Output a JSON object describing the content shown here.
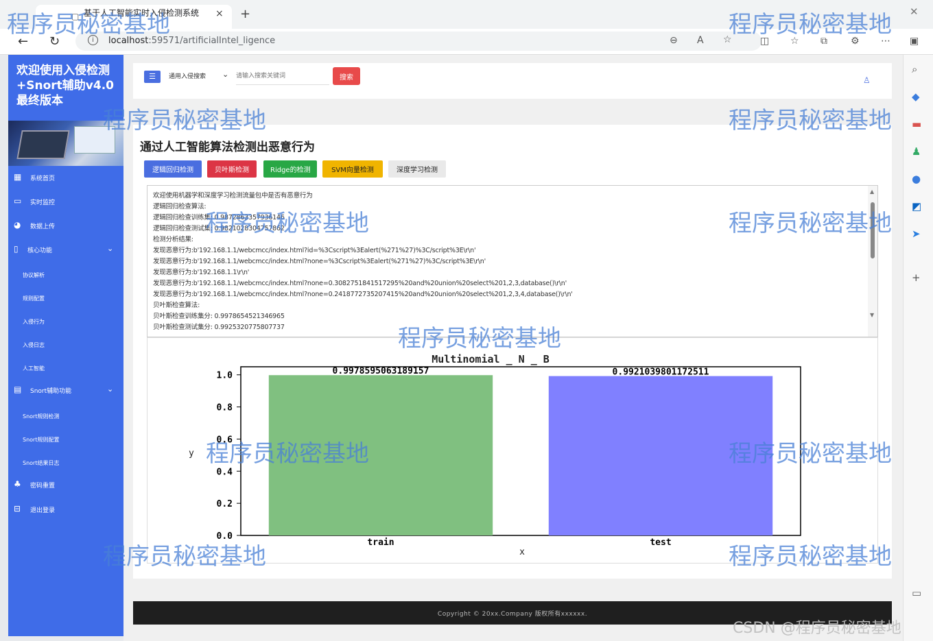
{
  "browser": {
    "tab_title": "基于人工智能实时入侵检测系统",
    "tab_close": "×",
    "new_tab": "+",
    "window_close": "✕",
    "url_host": "localhost",
    "url_rest": ":59571/artificialIntel_ligence"
  },
  "sidebar": {
    "brand": "欢迎使用入侵检测+Snort辅助v4.0最终版本",
    "items": [
      {
        "label": "系统首页",
        "icon": "grid-icon"
      },
      {
        "label": "实时监控",
        "icon": "monitor-icon"
      },
      {
        "label": "数据上传",
        "icon": "pie-icon"
      },
      {
        "label": "核心功能",
        "icon": "doc-icon"
      }
    ],
    "core_sub": [
      "协议解析",
      "规则配置",
      "入侵行为",
      "入侵日志",
      "人工智能"
    ],
    "snort_group": "Snort辅助功能",
    "snort_sub": [
      "Snort规则检测",
      "Snort规则配置",
      "Snort结果日志"
    ],
    "extra_items": [
      {
        "label": "密码重置",
        "icon": "users-icon"
      },
      {
        "label": "退出登录",
        "icon": "exit-icon"
      }
    ]
  },
  "topbar": {
    "select_value": "通用入侵搜索",
    "search_placeholder": "请输入搜索关键词",
    "search_button": "搜索"
  },
  "main": {
    "title": "通过人工智能算法检测出恶意行为",
    "buttons": [
      {
        "label": "逻辑回归检测",
        "color": "#4a6ee0"
      },
      {
        "label": "贝叶斯检测",
        "color": "#dc3545"
      },
      {
        "label": "Ridge的检测",
        "color": "#28a745"
      },
      {
        "label": "SVM向量检测",
        "color": "#f0b400"
      },
      {
        "label": "深度学习检测",
        "color": "#e9e9e9"
      }
    ],
    "log_lines": [
      "欢迎使用机器学和深度学习检测流量包中是否有恶意行为",
      "逻辑回归检查算法:",
      "逻辑回归检查训练集: 0.9872863357936146",
      "逻辑回归检查测试集: 0.9821028304757862",
      "检测分析结果:",
      "发现恶意行为:b'192.168.1.1/webcmcc/index.html?id=%3Cscript%3Ealert(%271%27)%3C/script%3E\\r\\n'",
      "发现恶意行为:b'192.168.1.1/webcmcc/index.html?none=%3Cscript%3Ealert(%271%27)%3C/script%3E\\r\\n'",
      "发现恶意行为:b'192.168.1.1\\r\\n'",
      "发现恶意行为:b'192.168.1.1/webcmcc/index.html?none=0.3082751841517295%20and%20union%20select%201,2,3,database()\\r\\n'",
      "发现恶意行为:b'192.168.1.1/webcmcc/index.html?none=0.2418772735207415%20and%20union%20select%201,2,3,4,database()\\r\\n'",
      "贝叶斯检查算法:",
      "贝叶斯检查训练集分: 0.9978654521346965",
      "贝叶斯检查测试集分: 0.9925320775807737"
    ]
  },
  "chart_data": {
    "type": "bar",
    "title": "Multinomial _ N _ B",
    "categories": [
      "train",
      "test"
    ],
    "values": [
      0.9978595063189157,
      0.9921039801172511
    ],
    "value_labels": [
      "0.9978595063189157",
      "0.9921039801172511"
    ],
    "colors": [
      "#80c080",
      "#8080ff"
    ],
    "xlabel": "x",
    "ylabel": "y",
    "ylim": [
      0,
      1.05
    ],
    "yticks": [
      "0.0",
      "0.2",
      "0.4",
      "0.6",
      "0.8",
      "1.0"
    ],
    "ytick_values": [
      0,
      0.2,
      0.4,
      0.6,
      0.8,
      1.0
    ]
  },
  "footer": {
    "text": "Copyright © 20xx.Company 版权所有xxxxxx."
  },
  "watermarks": {
    "text": "程序员秘密基地",
    "csdn": "CSDN @程序员秘密基地"
  }
}
